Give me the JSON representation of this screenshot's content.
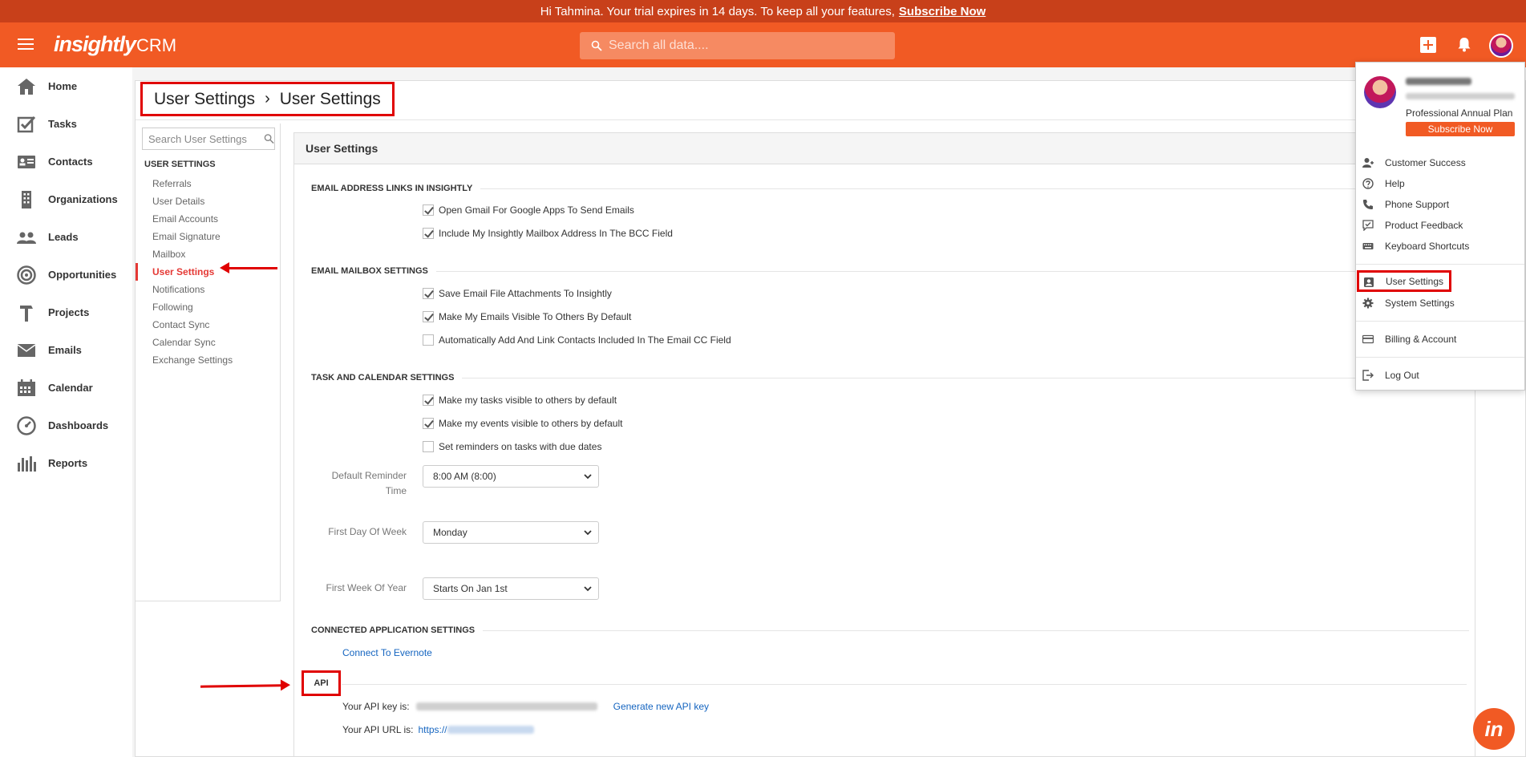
{
  "banner": {
    "text": "Hi Tahmina. Your trial expires in 14 days. To keep all your features,",
    "link": "Subscribe Now"
  },
  "topnav": {
    "logo": "insightly",
    "product": "CRM",
    "search_placeholder": "Search all data...."
  },
  "sidebar": {
    "items": [
      {
        "label": "Home",
        "icon": "home-icon"
      },
      {
        "label": "Tasks",
        "icon": "tasks-icon"
      },
      {
        "label": "Contacts",
        "icon": "contacts-icon"
      },
      {
        "label": "Organizations",
        "icon": "organizations-icon"
      },
      {
        "label": "Leads",
        "icon": "leads-icon"
      },
      {
        "label": "Opportunities",
        "icon": "opportunities-icon"
      },
      {
        "label": "Projects",
        "icon": "projects-icon"
      },
      {
        "label": "Emails",
        "icon": "emails-icon"
      },
      {
        "label": "Calendar",
        "icon": "calendar-icon"
      },
      {
        "label": "Dashboards",
        "icon": "dashboards-icon"
      },
      {
        "label": "Reports",
        "icon": "reports-icon"
      }
    ]
  },
  "breadcrumb": {
    "part1": "User Settings",
    "separator": "›",
    "part2": "User Settings"
  },
  "settings_nav": {
    "search_placeholder": "Search User Settings",
    "group_title": "USER SETTINGS",
    "items": [
      "Referrals",
      "User Details",
      "Email Accounts",
      "Email Signature",
      "Mailbox",
      "User Settings",
      "Notifications",
      "Following",
      "Contact Sync",
      "Calendar Sync",
      "Exchange Settings"
    ],
    "active": "User Settings"
  },
  "content": {
    "header": "User Settings",
    "sections": {
      "email_links": {
        "title": "EMAIL ADDRESS LINKS IN INSIGHTLY",
        "options": [
          {
            "label": "Open Gmail For Google Apps To Send Emails",
            "checked": true
          },
          {
            "label": "Include My Insightly Mailbox Address In The BCC Field",
            "checked": true
          }
        ]
      },
      "mailbox": {
        "title": "EMAIL MAILBOX SETTINGS",
        "options": [
          {
            "label": "Save Email File Attachments To Insightly",
            "checked": true
          },
          {
            "label": "Make My Emails Visible To Others By Default",
            "checked": true
          },
          {
            "label": "Automatically Add And Link Contacts Included In The Email CC Field",
            "checked": false
          }
        ]
      },
      "task_calendar": {
        "title": "TASK AND CALENDAR SETTINGS",
        "options": [
          {
            "label": "Make my tasks visible to others by default",
            "checked": true
          },
          {
            "label": "Make my events visible to others by default",
            "checked": true
          },
          {
            "label": "Set reminders on tasks with due dates",
            "checked": false
          }
        ],
        "reminder_label_1": "Default Reminder",
        "reminder_label_2": "Time",
        "reminder_value": "8:00 AM (8:00)",
        "first_day_label": "First Day Of Week",
        "first_day_value": "Monday",
        "first_week_label": "First Week Of Year",
        "first_week_value": "Starts On Jan 1st"
      },
      "connected": {
        "title": "CONNECTED APPLICATION SETTINGS",
        "link": "Connect To Evernote"
      },
      "api": {
        "title": "API",
        "key_label": "Your API key is:",
        "generate_link": "Generate new API key",
        "url_label": "Your API URL is:",
        "url_value": "https://"
      }
    }
  },
  "profile_menu": {
    "plan": "Professional Annual Plan",
    "subscribe": "Subscribe Now",
    "items": {
      "customer_success": "Customer Success",
      "help": "Help",
      "phone_support": "Phone Support",
      "product_feedback": "Product Feedback",
      "keyboard_shortcuts": "Keyboard Shortcuts",
      "user_settings": "User Settings",
      "system_settings": "System Settings",
      "billing": "Billing & Account",
      "logout": "Log Out"
    }
  },
  "colors": {
    "brand": "#f15a24",
    "banner": "#c8401a",
    "annotation_red": "#e00000",
    "link": "#1565c0"
  }
}
